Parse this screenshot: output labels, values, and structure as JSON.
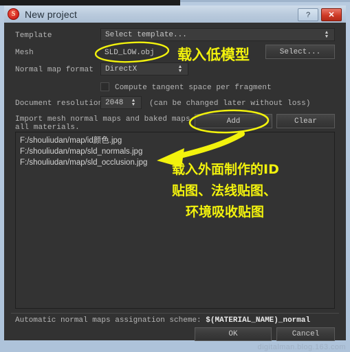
{
  "window": {
    "title": "New project",
    "app_icon": "substance-painter-icon",
    "help_label": "?",
    "close_label": "✕",
    "accent_close": "#cf3b27",
    "chrome_color": "#b8cbe0",
    "dialog_bg": "#323232"
  },
  "form": {
    "template": {
      "label": "Template",
      "value": "Select template...",
      "spinner": "⬍"
    },
    "mesh": {
      "label": "Mesh",
      "value": "SLD_LOW.obj",
      "button": "Select..."
    },
    "normal_map_format": {
      "label": "Normal map format",
      "value": "DirectX",
      "spinner": "⬍"
    },
    "compute_tangent": {
      "label": "Compute tangent space per fragment",
      "checked": false
    },
    "document_resolution": {
      "label": "Document resolution",
      "value": "2048",
      "spinner": "⬍",
      "hint": "(can be changed later without loss)"
    },
    "import_maps": {
      "description_line1": "Import mesh normal maps and baked maps for",
      "description_line2": "all materials.",
      "add_label": "Add",
      "clear_label": "Clear"
    },
    "file_list": [
      "F:/shouliudan/map/id颜色.jpg",
      "F:/shouliudan/map/sld_normals.jpg",
      "F:/shouliudan/map/sld_occlusion.jpg"
    ],
    "auto_scheme": {
      "label": "Automatic normal maps assignation scheme:",
      "value": "$(MATERIAL_NAME)_normal"
    }
  },
  "footer": {
    "ok_label": "OK",
    "cancel_label": "Cancel"
  },
  "annotations": {
    "color": "#f2f20d",
    "mesh_note": "载入低模型",
    "maps_note_line1": "载入外面制作的ID",
    "maps_note_line2": "贴图、法线贴图、",
    "maps_note_line3": "环境吸收贴图"
  },
  "watermark": "digitalman.blog.163.com"
}
